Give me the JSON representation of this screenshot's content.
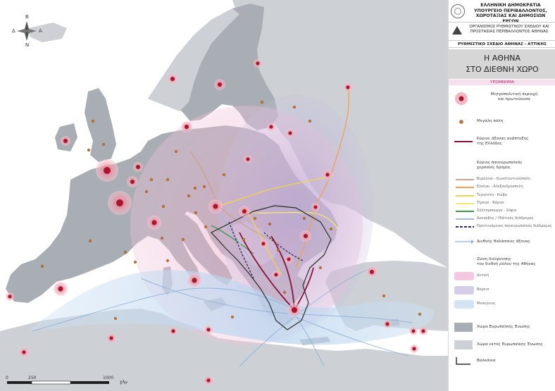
{
  "compass": {
    "n_top": "Β",
    "west": "Δ",
    "east": "Α",
    "s_bottom": "Ν"
  },
  "scale": {
    "t0": "0",
    "t1": "250",
    "t2": "1000",
    "unit": "χλμ"
  },
  "header": {
    "ministry_l1": "ΕΛΛΗΝΙΚΗ ΔΗΜΟΚΡΑΤΙΑ",
    "ministry_l2": "ΥΠΟΥΡΓΕΙΟ ΠΕΡΙΒΑΛΛΟΝΤΟΣ,",
    "ministry_l3": "ΧΩΡΟΤΑΞΙΑΣ ΚΑΙ ΔΗΜΟΣΙΩΝ ΕΡΓΩΝ",
    "org_l1": "ΟΡΓΑΝΙΣΜΟΣ ΡΥΘΜΙΣΤΙΚΟΥ ΣΧΕΔΙΟΥ ΚΑΙ",
    "org_l2": "ΠΡΟΣΤΑΣΙΑΣ ΠΕΡΙΒΑΛΛΟΝΤΟΣ ΑΘΗΝΑΣ",
    "plan": "ΡΥΘΜΙΣΤΙΚΟ ΣΧΕΔΙΟ ΑΘΗΝΑΣ - ΑΤΤΙΚΗΣ",
    "title_l1": "Η ΑΘΗΝΑ",
    "title_l2": "ΣΤΟ ΔΙΕΘΝΗ ΧΩΡΟ",
    "legend_heading": "ΥΠΟΜΝΗΜΑ"
  },
  "legend": {
    "metro_l1": "Μητροπολιτική περιοχή",
    "metro_l2": "και πρωτεύουσα",
    "city": "Μεγάλη πόλη",
    "axis_l1": "Κύριος άξονας ανάπτυξης",
    "axis_l2": "της Ελλάδος",
    "corridor_l1": "Κύριος πανευρωπαϊκός",
    "corridor_l2": "χερσαίος δρόμος",
    "routes": [
      {
        "label": "Βερολίνο - Κωνσταντινούπολη",
        "color": "#c9a38d",
        "dashed": false
      },
      {
        "label": "Ελσίνκι - Αλεξανδρούπολη",
        "color": "#f0a050",
        "dashed": false
      },
      {
        "label": "Τεργέστη - Κίεβο",
        "color": "#f2d34a",
        "dashed": false
      },
      {
        "label": "Τίρανα - Βάρνα",
        "color": "#f5e873",
        "dashed": false
      },
      {
        "label": "Σάλτσμπουργκ - Σόφια",
        "color": "#3a9a48",
        "dashed": false
      },
      {
        "label": "Δουνάβης / Υδάτινος διάδρομος",
        "color": "#a8b8d8",
        "dashed": false
      },
      {
        "label": "Προτεινόμενος πανευρωπαϊκός διάδρομος",
        "color": "#2a2a60",
        "dashed": true
      }
    ],
    "sea_axis": "Διεθνής θαλάσσιος άξονας",
    "zone_l1": "Ζώνη διεύρυνσης",
    "zone_l2": "του διεθνή ρόλου της Αθήνας",
    "zones": [
      {
        "label": "Δυτική",
        "color": "#f3c8e0"
      },
      {
        "label": "Βόρεια",
        "color": "#d6cde8"
      },
      {
        "label": "Μεσόγειος",
        "color": "#d3e4f4"
      }
    ],
    "eu": "Χώρα Ευρωπαϊκής Ένωσης",
    "non_eu": "Χώρα εκτός Ευρωπαϊκής Ένωσης",
    "balkans": "Βαλκάνια"
  },
  "colors": {
    "sea": "#ffffff",
    "eu_land": "#a9adb4",
    "non_eu_land": "#cdd0d5",
    "metro_red": "#a8152c",
    "metro_halo": "#f2b8c4",
    "axis": "#8b1038",
    "sea_route": "#8fb2d8"
  },
  "icons": {
    "compass": "compass-rose-icon",
    "seal": "greek-seal-icon",
    "org": "pyramid-logo-icon",
    "balkans": "balkans-bracket-icon"
  }
}
